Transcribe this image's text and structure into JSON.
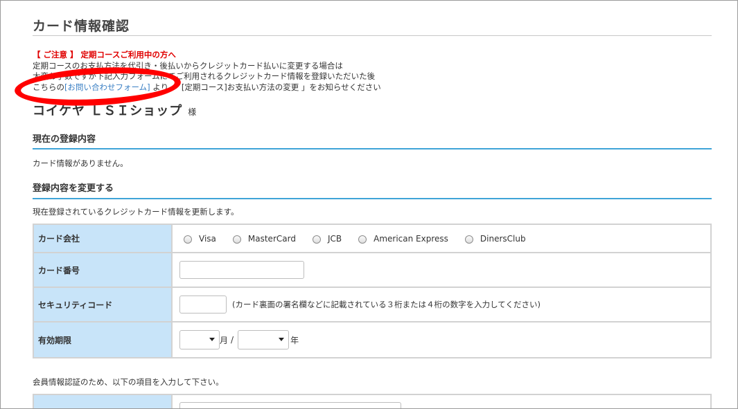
{
  "page": {
    "title": "カード情報確認"
  },
  "notice": {
    "heading": "【 ご注意 】 定期コースご利用中の方へ",
    "line1": "定期コースのお支払方法を代引き・後払いからクレジットカード払いに変更する場合は",
    "line2": "大変お手数ですが下記入力フォームにてご利用されるクレジットカード情報を登録いただいた後",
    "line3_pre": "こちらの",
    "link": "[お問い合わせフォーム]",
    "line3_post": " より 「 [定期コース]お支払い方法の変更 」をお知らせください"
  },
  "customer": {
    "name": "コイケヤ ＬＳＩショップ",
    "suffix": "様"
  },
  "current": {
    "heading": "現在の登録内容",
    "message": "カード情報がありません。"
  },
  "change": {
    "heading": "登録内容を変更する",
    "description": "現在登録されているクレジットカード情報を更新します。"
  },
  "form": {
    "card_company_label": "カード会社",
    "card_companies": [
      "Visa",
      "MasterCard",
      "JCB",
      "American Express",
      "DinersClub"
    ],
    "card_number_label": "カード番号",
    "card_number_value": "",
    "security_label": "セキュリティコード",
    "security_value": "",
    "security_hint": "(カード裏面の署名欄などに記載されている３桁または４桁の数字を入力してください)",
    "expiry_label": "有効期限",
    "expiry_month": "",
    "expiry_month_unit": "月",
    "expiry_sep": "/",
    "expiry_year": "",
    "expiry_year_unit": "年"
  },
  "member": {
    "description": "会員情報認証のため、以下の項目を入力して下さい。"
  },
  "colors": {
    "accent_rule": "#3fa4d8",
    "label_bg": "#c8e4f9",
    "warning": "#e00000",
    "link": "#3a7fc4",
    "annotation": "#ff0000"
  }
}
